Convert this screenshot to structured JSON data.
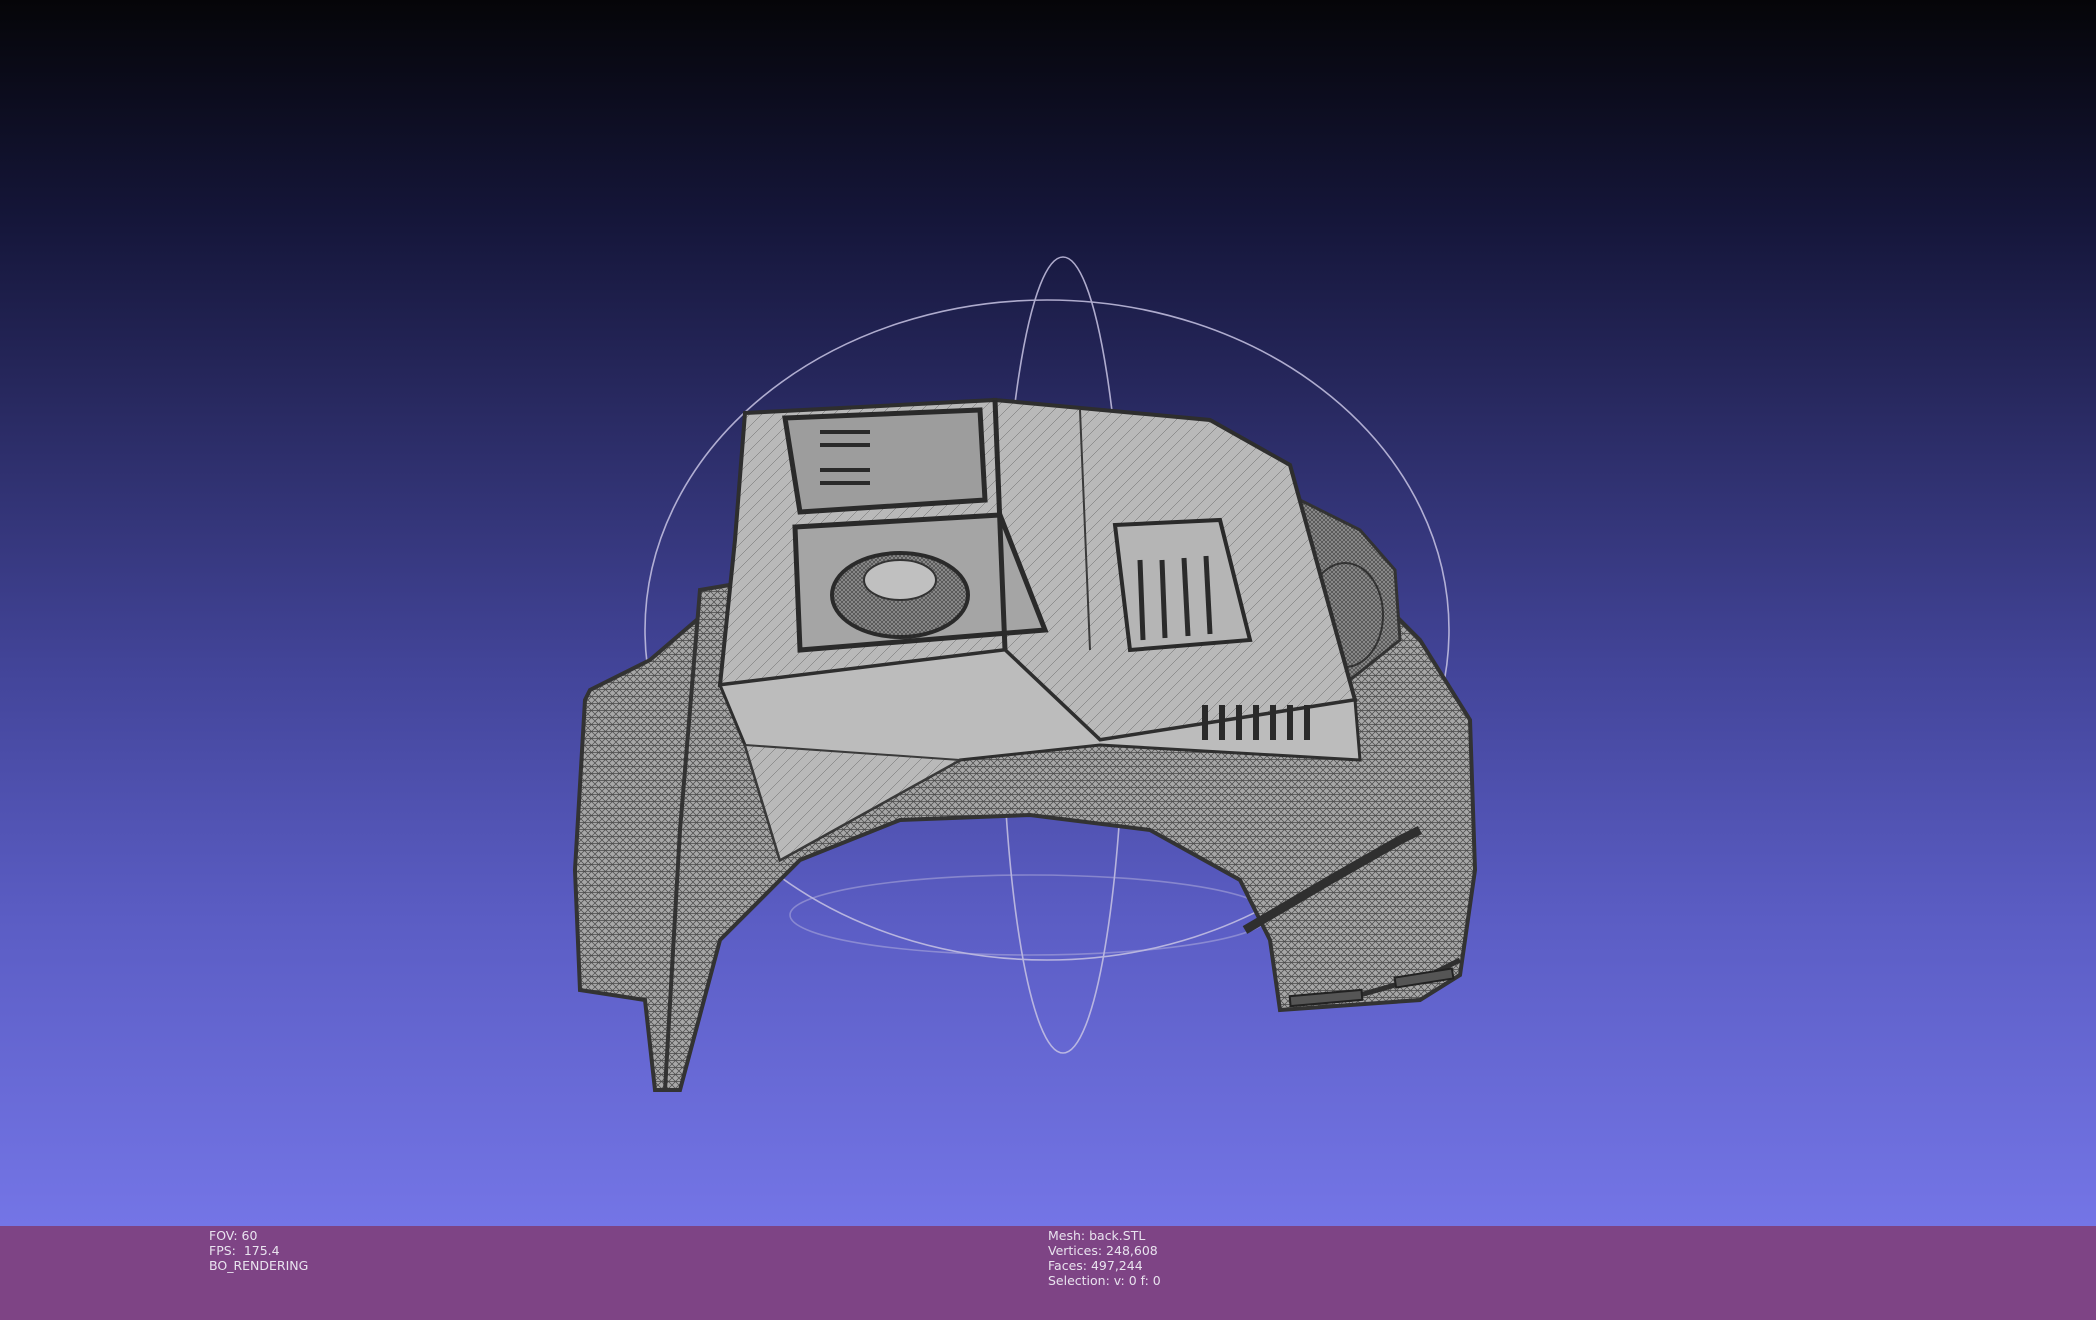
{
  "viewport": {
    "background_top": "#050508",
    "background_bottom": "#7475e6",
    "mesh_fill": "#9a9a9a",
    "mesh_edge": "#3c3c3c",
    "trackball_color": "#c8c4e4"
  },
  "status_left": {
    "fov": "FOV: 60",
    "fps": "FPS:  175.4",
    "mode": "BO_RENDERING"
  },
  "status_right": {
    "mesh": "Mesh: back.STL",
    "vertices": "Vertices: 248,608",
    "faces": "Faces: 497,244",
    "selection": "Selection: v: 0 f: 0"
  },
  "info_bar_color": "#7e4485"
}
